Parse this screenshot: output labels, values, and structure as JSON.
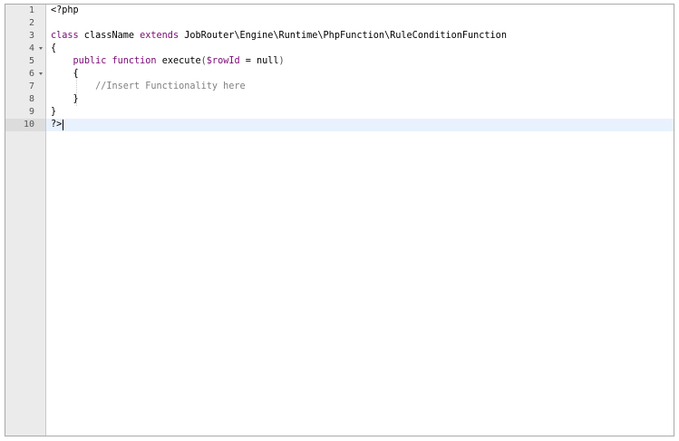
{
  "editor": {
    "language": "php",
    "active_line": 10,
    "gutter": [
      {
        "num": "1",
        "fold": false
      },
      {
        "num": "2",
        "fold": false
      },
      {
        "num": "3",
        "fold": false
      },
      {
        "num": "4",
        "fold": true
      },
      {
        "num": "5",
        "fold": false
      },
      {
        "num": "6",
        "fold": true
      },
      {
        "num": "7",
        "fold": false
      },
      {
        "num": "8",
        "fold": false
      },
      {
        "num": "9",
        "fold": false
      },
      {
        "num": "10",
        "fold": false
      }
    ],
    "lines": [
      {
        "text": "<?php"
      },
      {
        "text": ""
      },
      {
        "kw1": "class",
        "name": " className ",
        "kw2": "extends",
        "rest": " JobRouter\\Engine\\Runtime\\PhpFunction\\RuleConditionFunction"
      },
      {
        "text": "{"
      },
      {
        "indent": "    ",
        "kw1": "public",
        "sp": " ",
        "kw2": "function",
        "name": " execute",
        "p_open": "(",
        "var": "$rowId",
        "rest": " = null",
        "p_close": ")"
      },
      {
        "text": "    {"
      },
      {
        "indent": "        ",
        "comment": "//Insert Functionality here"
      },
      {
        "text": "    }"
      },
      {
        "text": "}"
      },
      {
        "text": "?>"
      }
    ]
  }
}
